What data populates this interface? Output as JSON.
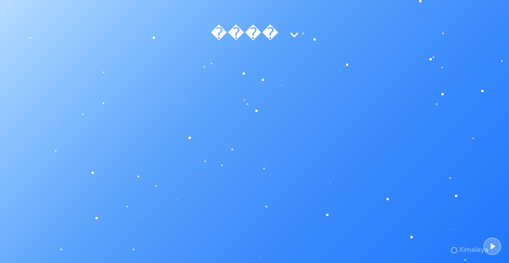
{
  "header": {
    "title": "����",
    "dropdown_icon": "chevron-down-icon"
  },
  "watermark": {
    "text": "Ximalaya"
  },
  "controls": {
    "play_icon": "play-icon"
  },
  "colors": {
    "gradient_start": "#b7dcff",
    "gradient_end": "#2176fb",
    "foreground": "#ffffff"
  }
}
